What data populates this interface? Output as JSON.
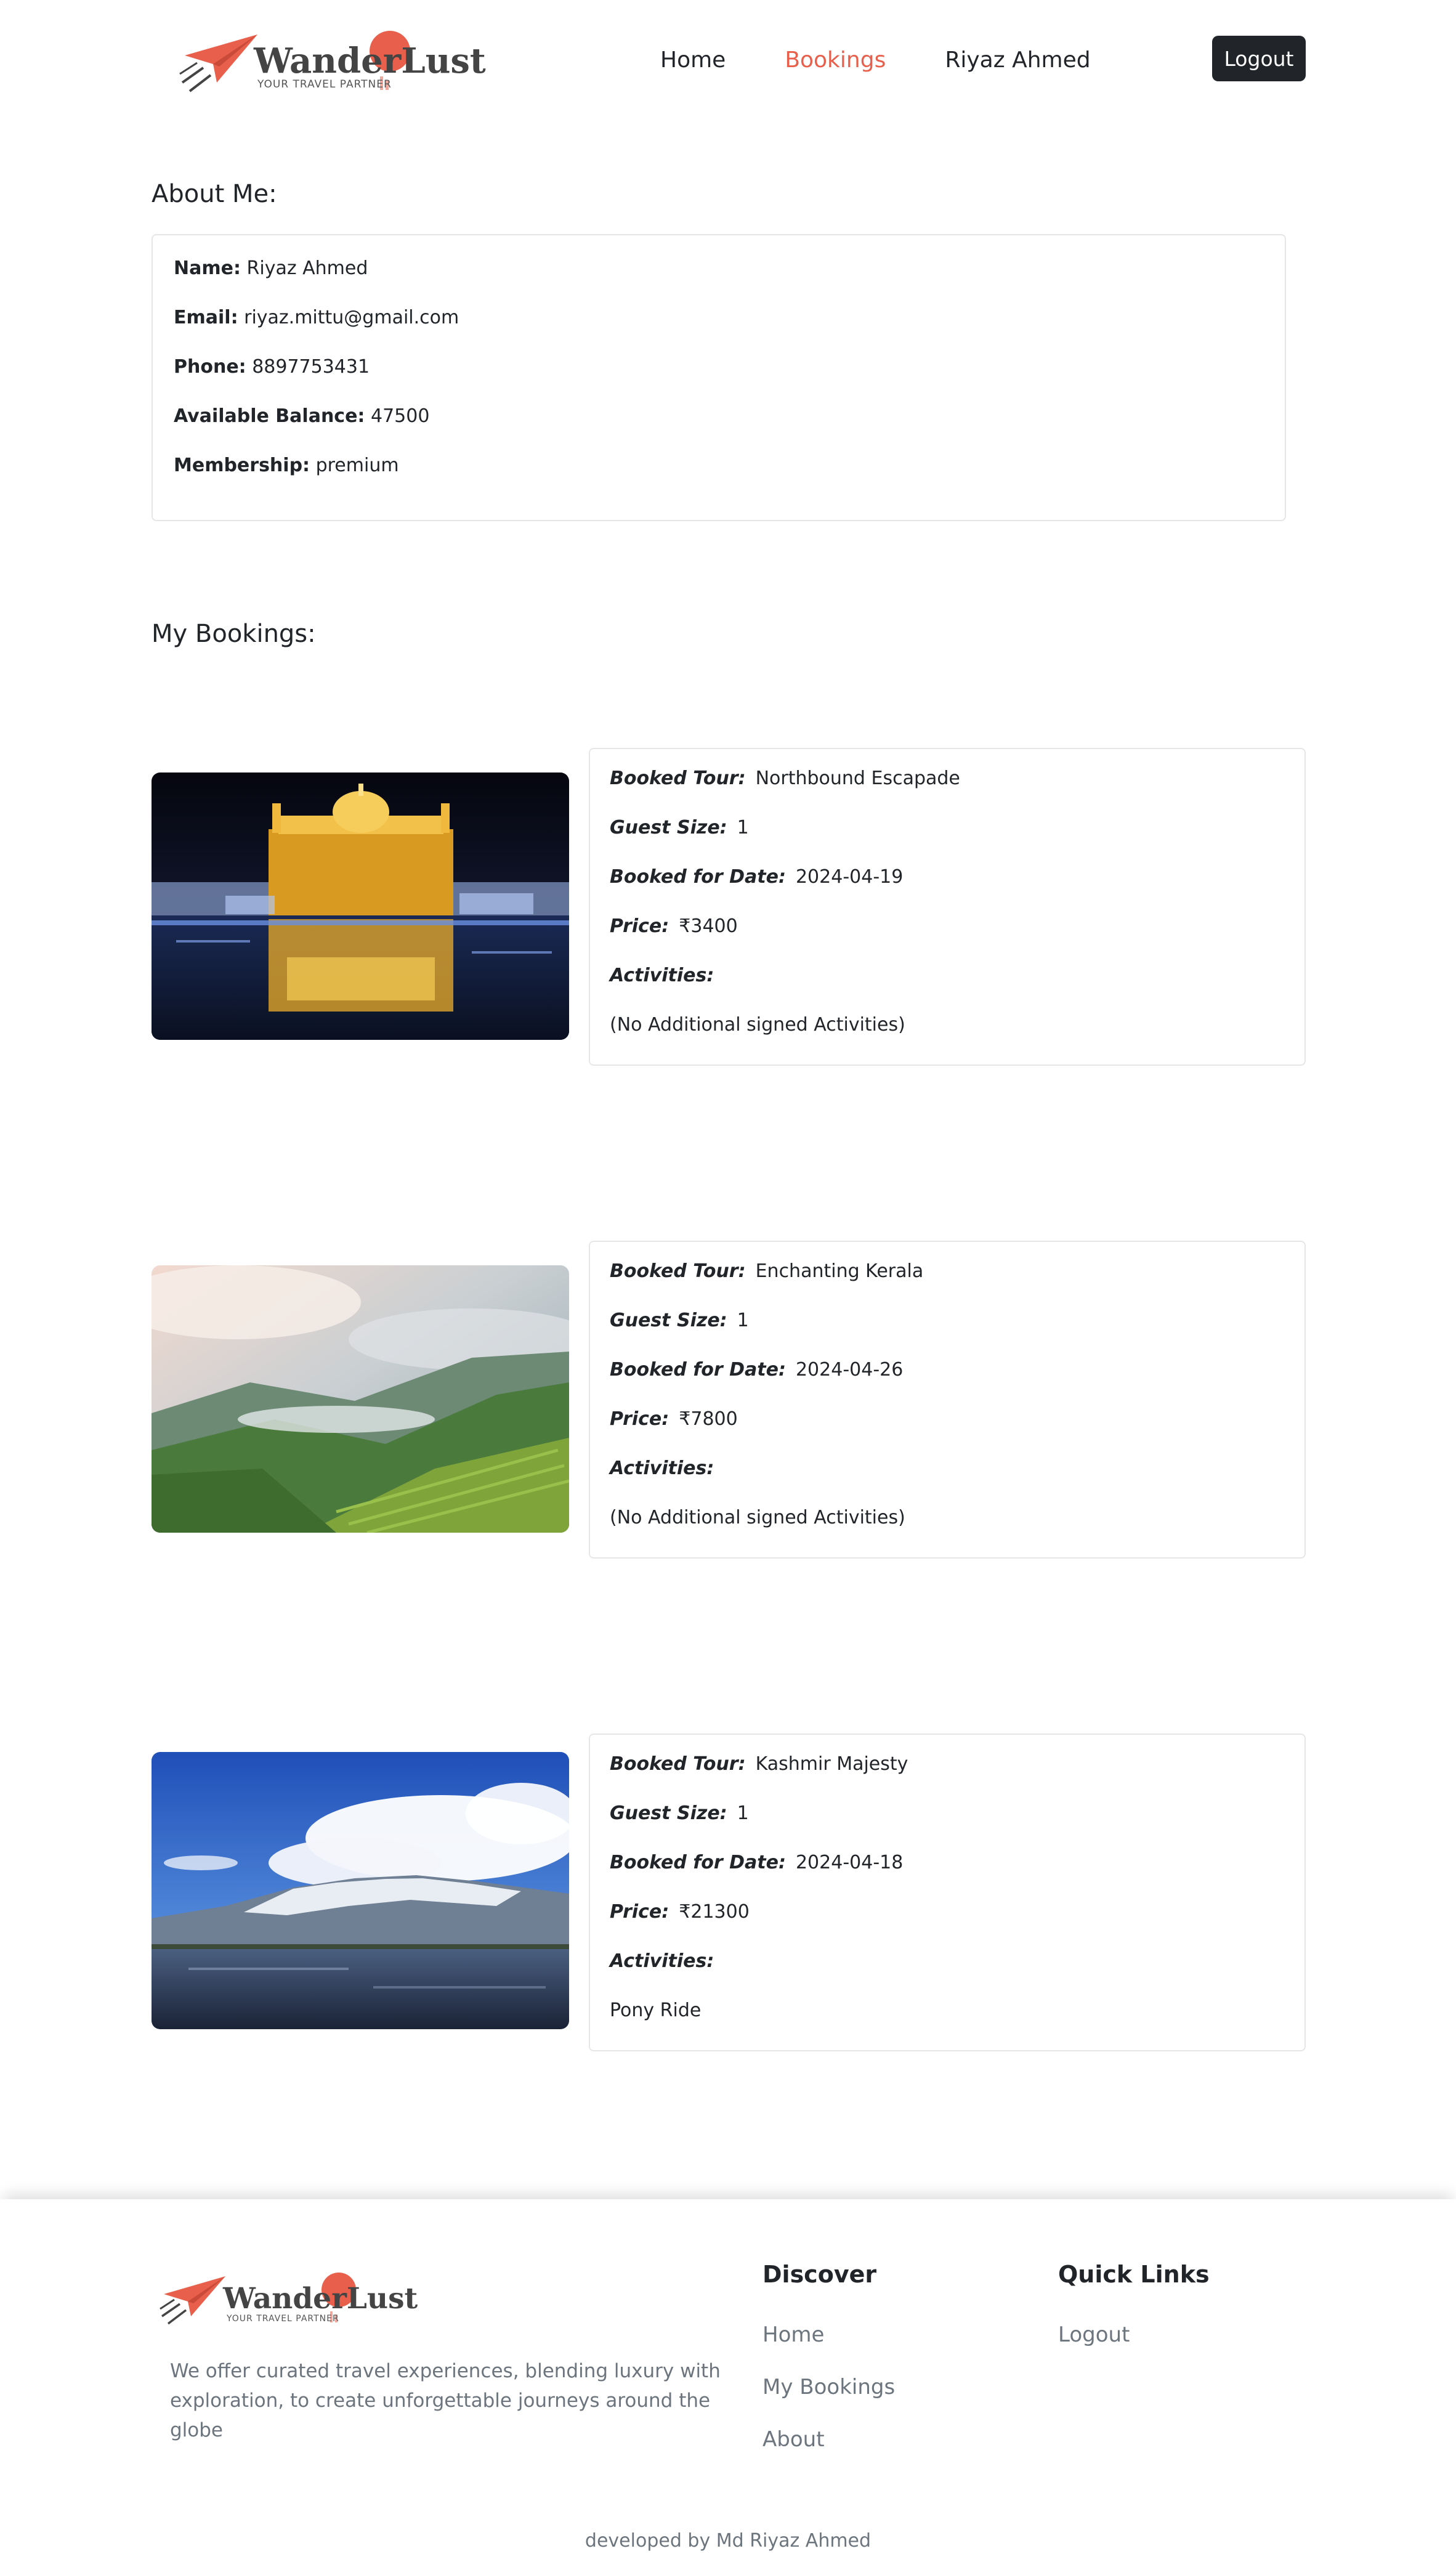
{
  "brand": {
    "name": "WanderLust",
    "tagline": "YOUR TRAVEL PARTNER",
    "accent_color": "#e8604c",
    "dark_color": "#212529"
  },
  "nav": {
    "items": [
      {
        "label": "Home",
        "active": false
      },
      {
        "label": "Bookings",
        "active": true
      },
      {
        "label": "Riyaz Ahmed",
        "active": false
      }
    ],
    "logout_label": "Logout"
  },
  "about": {
    "title": "About Me:",
    "fields": [
      {
        "label": "Name:",
        "value": "Riyaz Ahmed"
      },
      {
        "label": "Email:",
        "value": "riyaz.mittu@gmail.com"
      },
      {
        "label": "Phone:",
        "value": "8897753431"
      },
      {
        "label": "Available Balance:",
        "value": "47500"
      },
      {
        "label": "Membership:",
        "value": "premium"
      }
    ]
  },
  "bookings": {
    "title": "My Bookings:",
    "labels": {
      "tour": "Booked Tour:",
      "guests": "Guest Size:",
      "date": "Booked for Date:",
      "price": "Price:",
      "activities": "Activities:"
    },
    "items": [
      {
        "tour": "Northbound Escapade",
        "guests": "1",
        "date": "2024-04-19",
        "price": "₹3400",
        "activities": "(No Additional signed Activities)",
        "image": "golden-temple-night-photo"
      },
      {
        "tour": "Enchanting Kerala",
        "guests": "1",
        "date": "2024-04-26",
        "price": "₹7800",
        "activities": "(No Additional signed Activities)",
        "image": "kerala-tea-hills-photo"
      },
      {
        "tour": "Kashmir Majesty",
        "guests": "1",
        "date": "2024-04-18",
        "price": "₹21300",
        "activities": "Pony Ride",
        "image": "kashmir-lake-mountains-photo"
      }
    ]
  },
  "footer": {
    "description": "We offer curated travel experiences, blending luxury with exploration, to create unforgettable journeys around the globe",
    "discover": {
      "title": "Discover",
      "links": [
        "Home",
        "My Bookings",
        "About"
      ]
    },
    "quick_links": {
      "title": "Quick Links",
      "links": [
        "Logout"
      ]
    },
    "credit": "developed by Md Riyaz Ahmed"
  }
}
